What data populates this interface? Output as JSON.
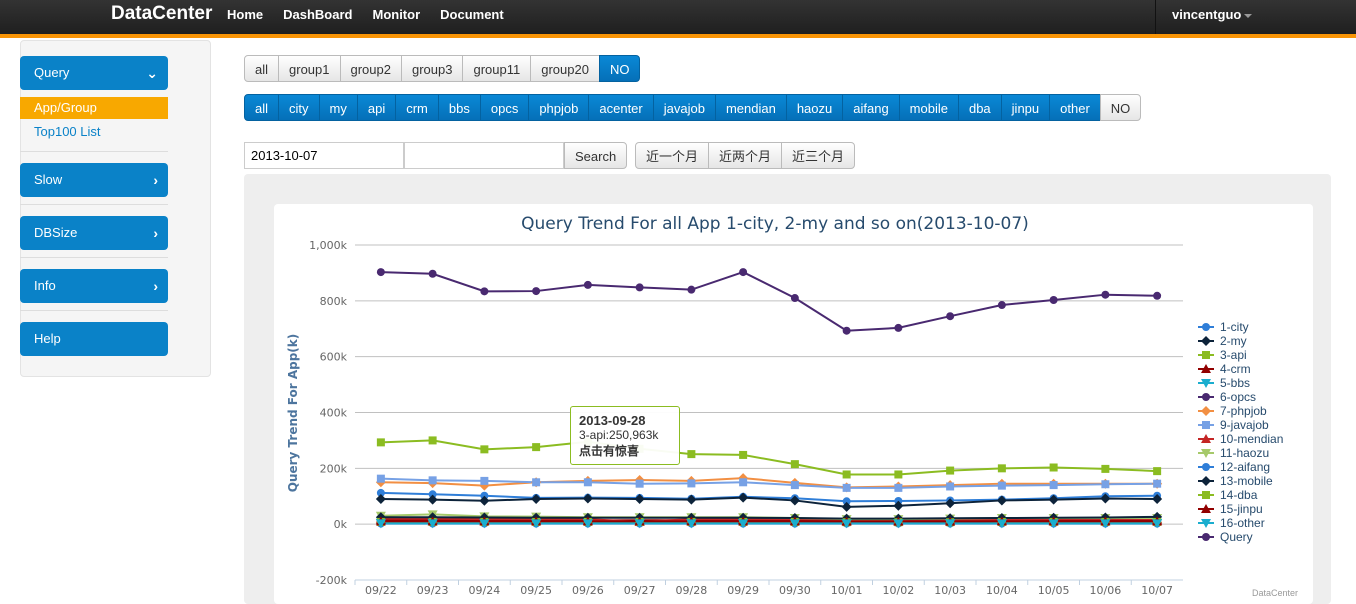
{
  "topbar": {
    "brand": "DataCenter",
    "nav": [
      "Home",
      "DashBoard",
      "Monitor",
      "Document"
    ],
    "user": "vincentguo"
  },
  "sidebar": {
    "query": "Query",
    "sub_items": [
      "App/Group",
      "Top100 List"
    ],
    "slow": "Slow",
    "dbsize": "DBSize",
    "info": "Info",
    "help": "Help"
  },
  "groups": [
    "all",
    "group1",
    "group2",
    "group3",
    "group11",
    "group20",
    "NO"
  ],
  "apps": [
    "all",
    "city",
    "my",
    "api",
    "crm",
    "bbs",
    "opcs",
    "phpjob",
    "acenter",
    "javajob",
    "mendian",
    "haozu",
    "aifang",
    "mobile",
    "dba",
    "jinpu",
    "other",
    "NO"
  ],
  "search": {
    "date_value": "2013-10-07",
    "second_value": "",
    "button": "Search"
  },
  "ranges": [
    "近一个月",
    "近两个月",
    "近三个月"
  ],
  "tooltip": {
    "date": "2013-09-28",
    "line": "3-api:250,963k",
    "note": "点击有惊喜"
  },
  "credit": "DataCenter",
  "colors": {
    "accent": "#f89406",
    "primary": "#0a82c8"
  },
  "chart_data": {
    "type": "line",
    "title": "Query Trend For all App 1-city, 2-my and so on(2013-10-07)",
    "ylabel": "Query Trend For App(k)",
    "xlabel": "",
    "ylim": [
      -200000,
      1000000
    ],
    "y_ticks": [
      "-200k",
      "0k",
      "200k",
      "400k",
      "600k",
      "800k",
      "1,000k"
    ],
    "categories": [
      "09/22",
      "09/23",
      "09/24",
      "09/25",
      "09/26",
      "09/27",
      "09/28",
      "09/29",
      "09/30",
      "10/01",
      "10/02",
      "10/03",
      "10/04",
      "10/05",
      "10/06",
      "10/07"
    ],
    "legend_position": "right",
    "series": [
      {
        "name": "1-city",
        "color": "#2f7ed8",
        "marker": "circle",
        "values": [
          112000,
          107000,
          102000,
          94000,
          95000,
          94000,
          91000,
          98000,
          93000,
          82000,
          83000,
          85000,
          88000,
          93000,
          100000,
          102000
        ]
      },
      {
        "name": "2-my",
        "color": "#0d233a",
        "marker": "diamond",
        "values": [
          90000,
          88000,
          84000,
          90000,
          92000,
          90000,
          88000,
          95000,
          85000,
          62000,
          66000,
          75000,
          85000,
          88000,
          92000,
          90000
        ]
      },
      {
        "name": "3-api",
        "color": "#8bbc21",
        "marker": "square",
        "values": [
          293000,
          300000,
          268000,
          276000,
          295000,
          270000,
          250963,
          248000,
          215000,
          178000,
          178000,
          192000,
          200000,
          203000,
          198000,
          190000
        ]
      },
      {
        "name": "4-crm",
        "color": "#910000",
        "marker": "triangle",
        "values": [
          15000,
          15000,
          14000,
          14000,
          13000,
          14000,
          14000,
          15000,
          13000,
          12000,
          12000,
          13000,
          13000,
          14000,
          14000,
          14000
        ]
      },
      {
        "name": "5-bbs",
        "color": "#1aadce",
        "marker": "triangle-down",
        "values": [
          5000,
          5000,
          5000,
          5000,
          5000,
          5000,
          5000,
          5000,
          5000,
          4000,
          4000,
          4000,
          5000,
          5000,
          5000,
          5000
        ]
      },
      {
        "name": "6-opcs",
        "color": "#492970",
        "marker": "circle",
        "values": [
          903000,
          897000,
          834000,
          835000,
          857000,
          848000,
          840000,
          903000,
          810000,
          693000,
          703000,
          745000,
          785000,
          803000,
          822000,
          818000
        ]
      },
      {
        "name": "7-phpjob",
        "color": "#f28f43",
        "marker": "diamond",
        "values": [
          150000,
          147000,
          138000,
          150000,
          155000,
          158000,
          155000,
          165000,
          148000,
          132000,
          135000,
          140000,
          145000,
          145000,
          145000,
          145000
        ]
      },
      {
        "name": "9-javajob",
        "color": "#77a1e5",
        "marker": "square",
        "values": [
          163000,
          157000,
          155000,
          150000,
          150000,
          145000,
          146000,
          150000,
          140000,
          130000,
          130000,
          135000,
          138000,
          140000,
          143000,
          145000
        ]
      },
      {
        "name": "10-mendian",
        "color": "#c42525",
        "marker": "triangle",
        "values": [
          20000,
          20000,
          18000,
          18000,
          18000,
          8000,
          18000,
          18000,
          18000,
          17000,
          17000,
          17000,
          17000,
          18000,
          18000,
          18000
        ]
      },
      {
        "name": "11-haozu",
        "color": "#a6c96a",
        "marker": "triangle-down",
        "values": [
          30000,
          35000,
          28000,
          27000,
          25000,
          25000,
          25000,
          25000,
          22000,
          18000,
          18000,
          20000,
          22000,
          22000,
          22000,
          22000
        ]
      },
      {
        "name": "12-aifang",
        "color": "#2f7ed8",
        "marker": "circle",
        "values": [
          2000,
          2000,
          2000,
          2000,
          2000,
          2000,
          2000,
          2000,
          2000,
          2000,
          2000,
          2000,
          2000,
          2000,
          2000,
          2000
        ]
      },
      {
        "name": "13-mobile",
        "color": "#0d233a",
        "marker": "diamond",
        "values": [
          25000,
          25000,
          24000,
          23000,
          23000,
          23000,
          23000,
          23000,
          22000,
          20000,
          20000,
          21000,
          22000,
          23000,
          24000,
          26000
        ]
      },
      {
        "name": "14-dba",
        "color": "#8bbc21",
        "marker": "square",
        "values": [
          8000,
          8000,
          8000,
          8000,
          8000,
          8000,
          8000,
          8000,
          8000,
          7000,
          7000,
          7000,
          8000,
          8000,
          8000,
          8000
        ]
      },
      {
        "name": "15-jinpu",
        "color": "#910000",
        "marker": "triangle",
        "values": [
          10000,
          10000,
          10000,
          10000,
          10000,
          10000,
          10000,
          10000,
          10000,
          9000,
          9000,
          9000,
          10000,
          10000,
          10000,
          10000
        ]
      },
      {
        "name": "16-other",
        "color": "#1aadce",
        "marker": "triangle-down",
        "values": [
          3000,
          3000,
          3000,
          3000,
          3000,
          3000,
          3000,
          3000,
          3000,
          3000,
          3000,
          3000,
          3000,
          3000,
          3000,
          3000
        ]
      },
      {
        "name": "Query",
        "color": "#492970",
        "marker": "circle",
        "values": []
      }
    ]
  }
}
